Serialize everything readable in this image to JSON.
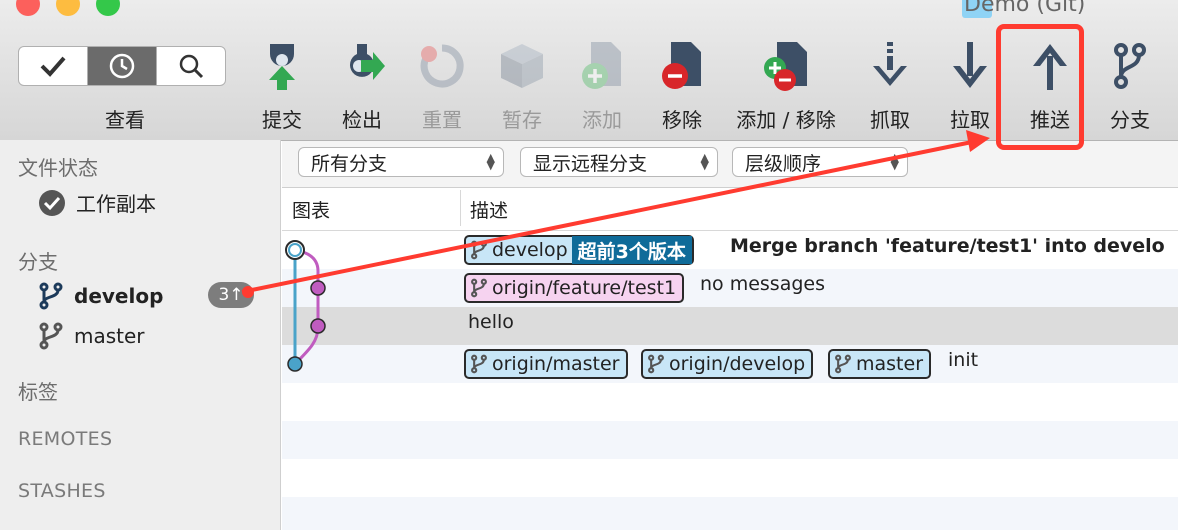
{
  "window": {
    "title": "Demo (Git)"
  },
  "toolbar": {
    "view_label": "查看",
    "commit": "提交",
    "checkout": "检出",
    "reset": "重置",
    "stash": "暂存",
    "add": "添加",
    "remove": "移除",
    "add_remove": "添加 / 移除",
    "fetch": "抓取",
    "pull": "拉取",
    "push": "推送",
    "branch": "分支"
  },
  "sidebar": {
    "file_status_header": "文件状态",
    "working_copy": "工作副本",
    "branches_header": "分支",
    "branches": [
      {
        "name": "develop",
        "badge": "3↑"
      },
      {
        "name": "master"
      }
    ],
    "tags_header": "标签",
    "remotes_header": "REMOTES",
    "stashes_header": "STASHES"
  },
  "filters": {
    "branch_filter": "所有分支",
    "remote_filter": "显示远程分支",
    "order_filter": "层级顺序"
  },
  "columns": {
    "graph": "图表",
    "description": "描述"
  },
  "commits": [
    {
      "tags": [
        {
          "name": "develop",
          "ahead": "超前3个版本"
        }
      ],
      "message": "Merge branch 'feature/test1' into develo"
    },
    {
      "tags": [
        {
          "name": "origin/feature/test1"
        }
      ],
      "message": "no messages"
    },
    {
      "tags": [],
      "message": "hello"
    },
    {
      "tags": [
        {
          "name": "origin/master"
        },
        {
          "name": "origin/develop"
        },
        {
          "name": "master"
        }
      ],
      "message": "init"
    }
  ],
  "colors": {
    "accent_blue": "#0f6b99",
    "annotation_red": "#ff3b30",
    "graph_blue": "#4aa3c9",
    "graph_purple": "#c05cc0"
  }
}
